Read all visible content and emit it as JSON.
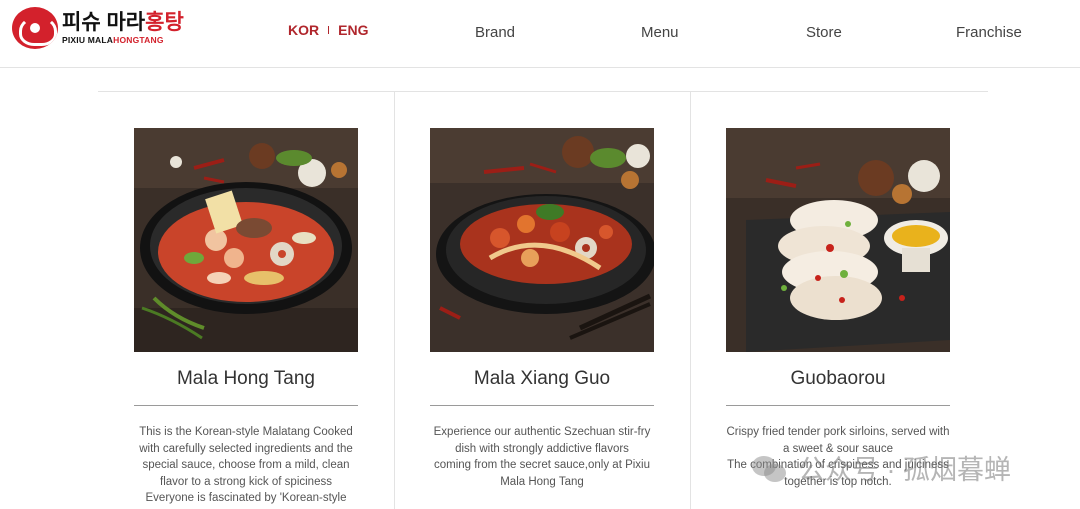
{
  "header": {
    "logo": {
      "korean_part1": "피슈",
      "korean_part2": "마라",
      "korean_part3": "홍탕",
      "english_part1": "PIXIU MALA",
      "english_part2": "HONGTANG"
    },
    "lang": {
      "kor": "KOR",
      "eng": "ENG"
    },
    "nav": [
      {
        "label": "Brand"
      },
      {
        "label": "Menu"
      },
      {
        "label": "Store"
      },
      {
        "label": "Franchise"
      }
    ]
  },
  "menu_items": [
    {
      "title": "Mala Hong Tang",
      "description_lines": [
        "This is the Korean-style Malatang Cooked",
        "with carefully selected ingredients and the",
        "special sauce, choose from a mild, clean",
        "flavor to a strong kick of spiciness",
        "Everyone is fascinated by 'Korean-style"
      ]
    },
    {
      "title": "Mala Xiang Guo",
      "description_lines": [
        "Experience our authentic Szechuan stir-fry",
        "dish with strongly addictive flavors",
        "coming from the secret sauce,only at Pixiu",
        "Mala Hong Tang"
      ]
    },
    {
      "title": "Guobaorou",
      "description_lines": [
        "Crispy fried tender pork sirloins, served with",
        "a sweet & sour sauce",
        "The combination of crispiness and juiciness",
        "together is top notch."
      ]
    }
  ],
  "watermark": {
    "text": "公众号 · 孤烟暮蝉"
  },
  "colors": {
    "accent": "#b0262c",
    "logo_red": "#d3212c",
    "divider": "#e3e3e3"
  }
}
